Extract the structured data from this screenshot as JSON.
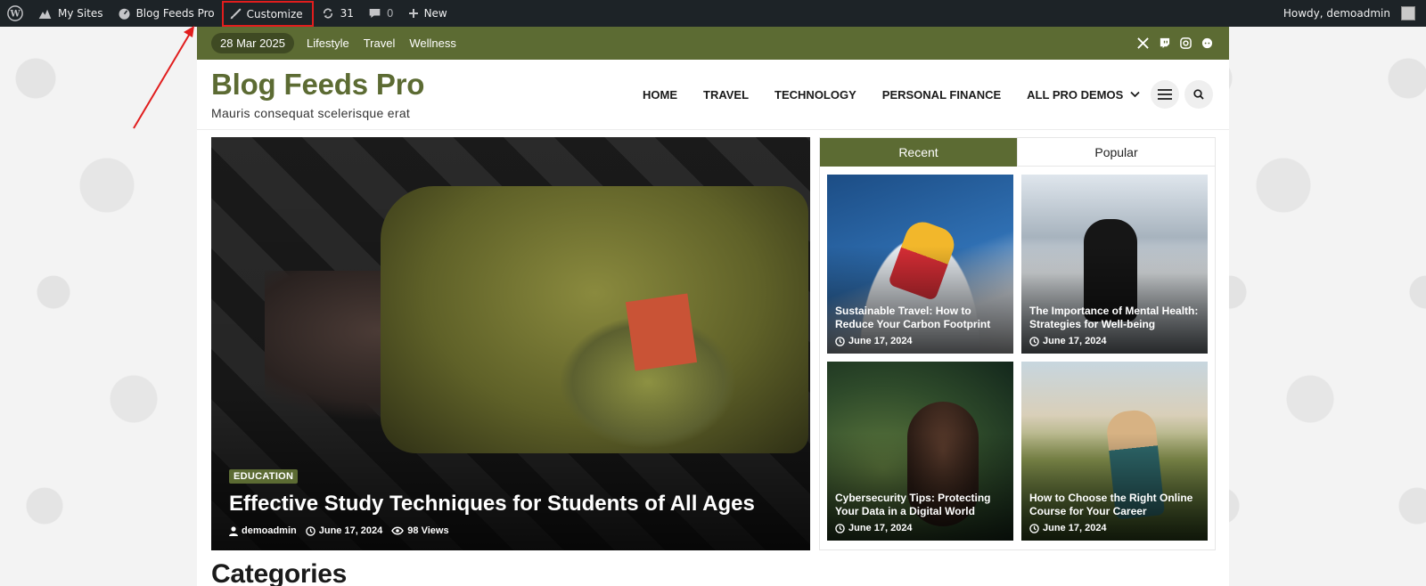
{
  "adminbar": {
    "my_sites": "My Sites",
    "site_name": "Blog Feeds Pro",
    "customize": "Customize",
    "updates_count": "31",
    "comments_count": "0",
    "new": "New",
    "howdy": "Howdy, demoadmin"
  },
  "topbar": {
    "date": "28 Mar 2025",
    "links": [
      "Lifestyle",
      "Travel",
      "Wellness"
    ]
  },
  "header": {
    "title": "Blog Feeds Pro",
    "tagline": "Mauris consequat scelerisque erat",
    "nav": [
      "HOME",
      "TRAVEL",
      "TECHNOLOGY",
      "PERSONAL FINANCE",
      "ALL PRO DEMOS"
    ]
  },
  "hero": {
    "category": "EDUCATION",
    "title": "Effective Study Techniques for Students of All Ages",
    "author": "demoadmin",
    "date": "June 17, 2024",
    "views": "98 Views"
  },
  "widget": {
    "tabs": [
      "Recent",
      "Popular"
    ],
    "cards": [
      {
        "title": "Sustainable Travel: How to Reduce Your Carbon Footprint",
        "date": "June 17, 2024"
      },
      {
        "title": "The Importance of Mental Health: Strategies for Well-being",
        "date": "June 17, 2024"
      },
      {
        "title": "Cybersecurity Tips: Protecting Your Data in a Digital World",
        "date": "June 17, 2024"
      },
      {
        "title": "How to Choose the Right Online Course for Your Career",
        "date": "June 17, 2024"
      }
    ]
  },
  "sections": {
    "categories": "Categories"
  },
  "colors": {
    "accent": "#5c6b33",
    "adminbar": "#1d2327",
    "highlight": "#e11d1d"
  }
}
